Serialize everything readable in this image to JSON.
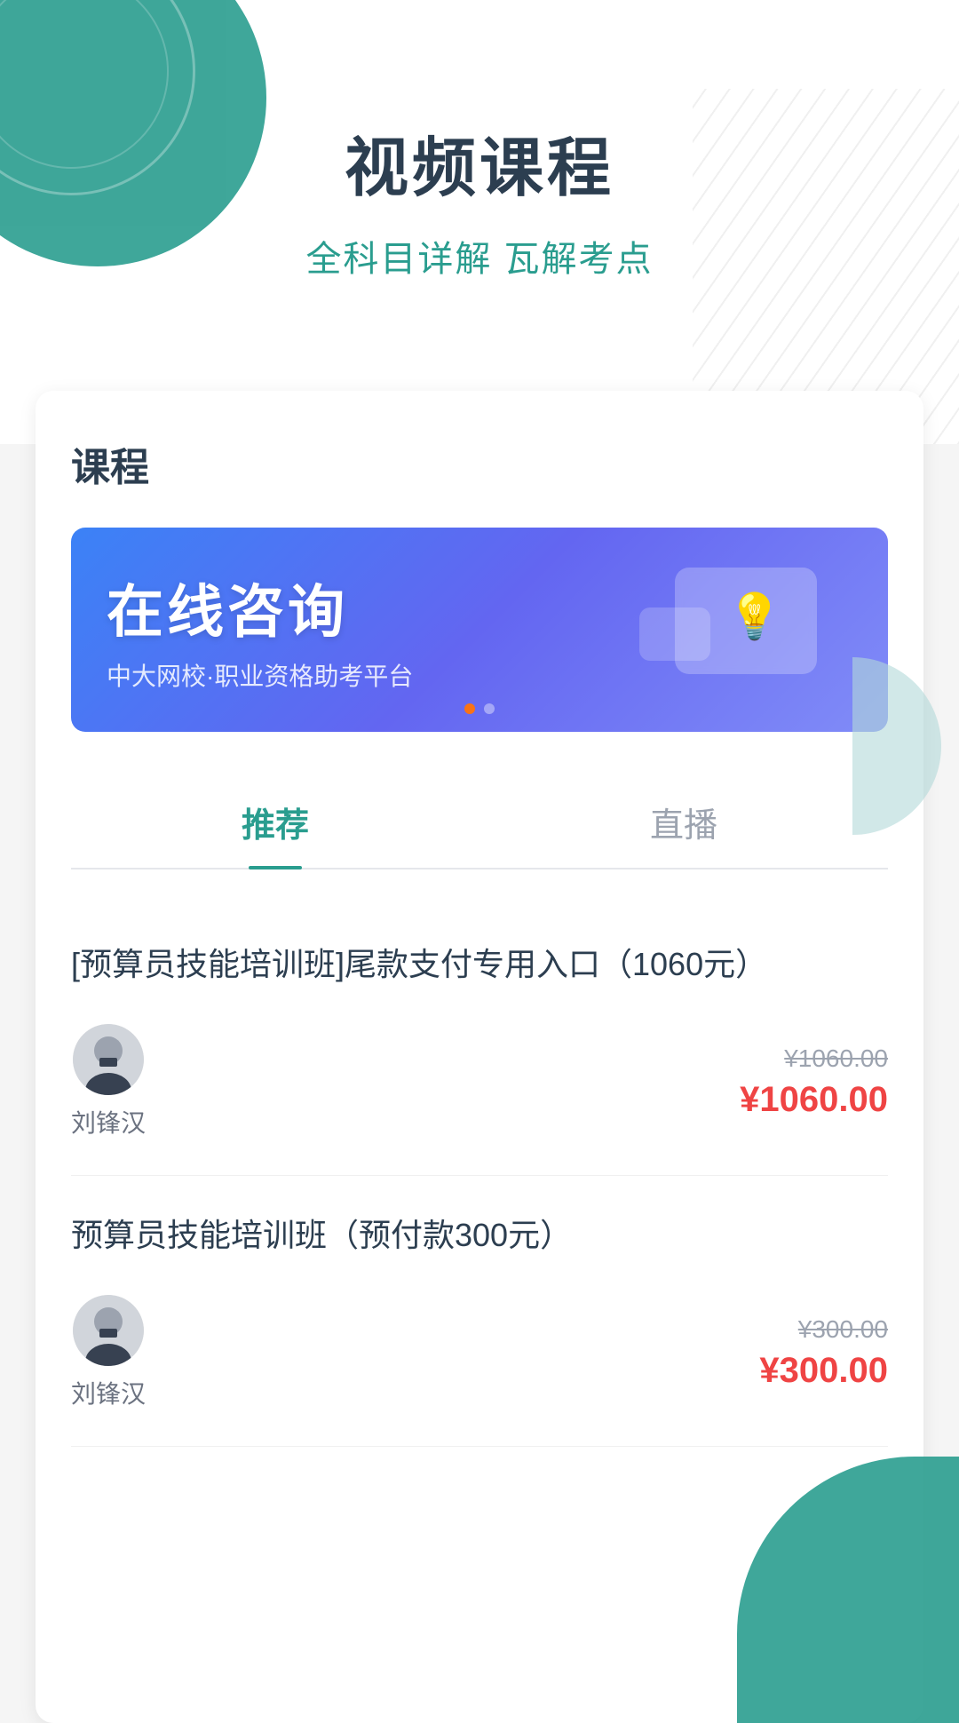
{
  "hero": {
    "title": "视频课程",
    "subtitle": "全科目详解 瓦解考点"
  },
  "section": {
    "title": "课程"
  },
  "banner": {
    "main_text": "在线咨询",
    "sub_text": "中大网校·职业资格助考平台"
  },
  "tabs": [
    {
      "label": "推荐",
      "active": true
    },
    {
      "label": "直播",
      "active": false
    }
  ],
  "courses": [
    {
      "title": "[预算员技能培训班]尾款支付专用入口（1060元）",
      "teacher": "刘锋汉",
      "original_price": "¥1060.00",
      "current_price": "¥1060.00"
    },
    {
      "title": "预算员技能培训班（预付款300元）",
      "teacher": "刘锋汉",
      "original_price": "¥300.00",
      "current_price": "¥300.00"
    }
  ],
  "colors": {
    "teal": "#2a9d8f",
    "accent_red": "#ef4444",
    "tab_active": "#2a9d8f"
  }
}
